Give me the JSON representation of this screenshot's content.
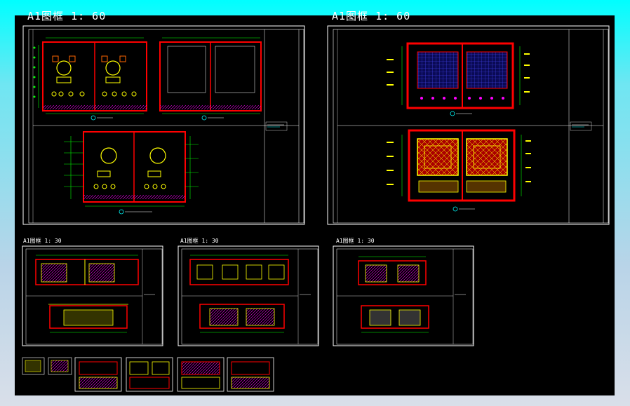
{
  "sheets": {
    "sheet_1": {
      "title": "A1图框  1: 60"
    },
    "sheet_2": {
      "title": "A1图框  1: 60"
    },
    "sheet_3": {
      "title": "A1图框  1: 30"
    },
    "sheet_4": {
      "title": "A1图框  1: 30"
    },
    "sheet_5": {
      "title": "A1图框  1: 30"
    }
  },
  "colors": {
    "background_gradient_top": "#00ffff",
    "background_gradient_bottom": "#d9dfe9",
    "canvas": "#000000",
    "frame": "#ffffff",
    "wall": "#ff0000",
    "furniture": "#ffff00",
    "dimension": "#00ff00",
    "grid": "#3b3bff",
    "pattern": "#ff00ff"
  }
}
